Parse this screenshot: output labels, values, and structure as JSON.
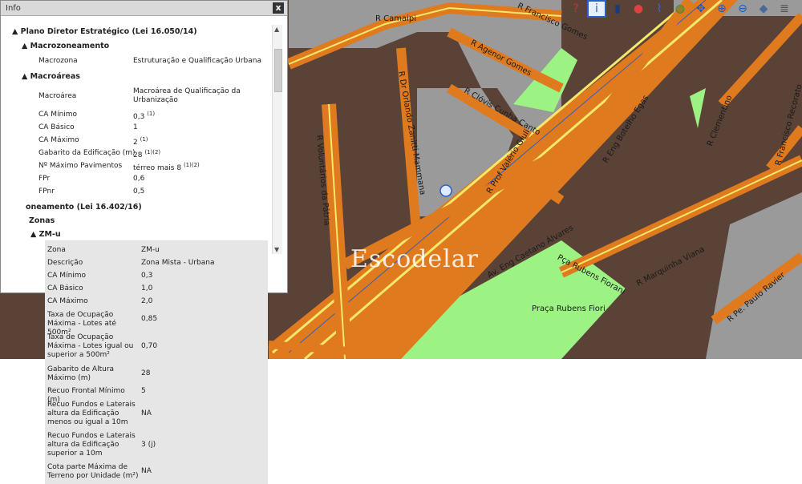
{
  "panel": {
    "title": "Info",
    "close": "x"
  },
  "plano": {
    "title": "Plano Diretor Estratégico (Lei 16.050/14)",
    "macrozoneamento": {
      "title": "Macrozoneamento",
      "rows": [
        {
          "k": "Macrozona",
          "v": "Estruturação e Qualificação Urbana"
        }
      ]
    },
    "macroareas": {
      "title": "Macroáreas",
      "rows": [
        {
          "k": "Macroárea",
          "v": "Macroárea de Qualificação da Urbanização"
        },
        {
          "k": "CA Mínimo",
          "v": "0,3",
          "sup": "(1)"
        },
        {
          "k": "CA Básico",
          "v": "1",
          "sup": ""
        },
        {
          "k": "CA Máximo",
          "v": "2",
          "sup": "(1)"
        },
        {
          "k": "Gabarito da Edificação (m)",
          "v": "28",
          "sup": "(1)(2)"
        },
        {
          "k": "Nº Máximo Pavimentos",
          "v": "térreo mais 8",
          "sup": "(1)(2)"
        },
        {
          "k": "FPr",
          "v": "0,6",
          "sup": ""
        },
        {
          "k": "FPnr",
          "v": "0,5",
          "sup": ""
        }
      ]
    }
  },
  "zoneamento": {
    "title": "oneamento (Lei 16.402/16)",
    "zonas": "Zonas",
    "zone": "ZM-u",
    "rows": [
      {
        "k": "Zona",
        "v": "ZM-u"
      },
      {
        "k": "Descrição",
        "v": "Zona Mista - Urbana"
      },
      {
        "k": "CA Mínimo",
        "v": "0,3"
      },
      {
        "k": "CA Básico",
        "v": "1,0"
      },
      {
        "k": "CA Máximo",
        "v": "2,0"
      },
      {
        "k": "Taxa de Ocupação Máxima - Lotes até 500m²",
        "v": "0,85"
      },
      {
        "k": "Taxa de Ocupação Máxima - Lotes igual ou superior a 500m²",
        "v": "0,70"
      },
      {
        "k": "Gabarito de Altura Máximo (m)",
        "v": "28"
      },
      {
        "k": "Recuo Frontal Mínimo (m)",
        "v": "5"
      },
      {
        "k": "Recuo Fundos e Laterais altura da Edificação menos ou igual a 10m",
        "v": "NA"
      },
      {
        "k": "Recuo Fundos e Laterais altura da Edificação superior a 10m",
        "v": "3 (j)"
      },
      {
        "k": "Cota parte Máxima de Terreno por Unidade (m²)",
        "v": "NA"
      }
    ]
  },
  "map": {
    "streets": [
      "R Camaipi",
      "R Francisco Gomes",
      "R Agenor Gomes",
      "R Dr Orlando Zanitti Mammana",
      "R Clóvis Cunha Canto",
      "R Prof Valério Giuli",
      "R Eng Botelho Egas",
      "R Clementino",
      "R Francisco Recorato",
      "R Voluntários da Pátria",
      "Av. Eng Caetano Álvares",
      "Pça Rubens Fiorani",
      "R Marquinha Viana",
      "R Pe. Paulo Ravier"
    ],
    "park": "Praça Rubens Fiori",
    "watermark": "Escodelar"
  },
  "toolbar": {
    "icons": [
      "help-icon",
      "info-icon",
      "chart-icon",
      "route-icon",
      "measure-icon",
      "globe-icon",
      "pan-icon",
      "zoom-in-icon",
      "zoom-out-icon",
      "layers-icon",
      "stack-icon"
    ]
  },
  "colors": {
    "block": "#5a4237",
    "road": "#e07a1e",
    "road_center": "#f3e96a",
    "grey_lot": "#9a9a9a",
    "park": "#9cf283",
    "accent": "#2a60c8"
  }
}
